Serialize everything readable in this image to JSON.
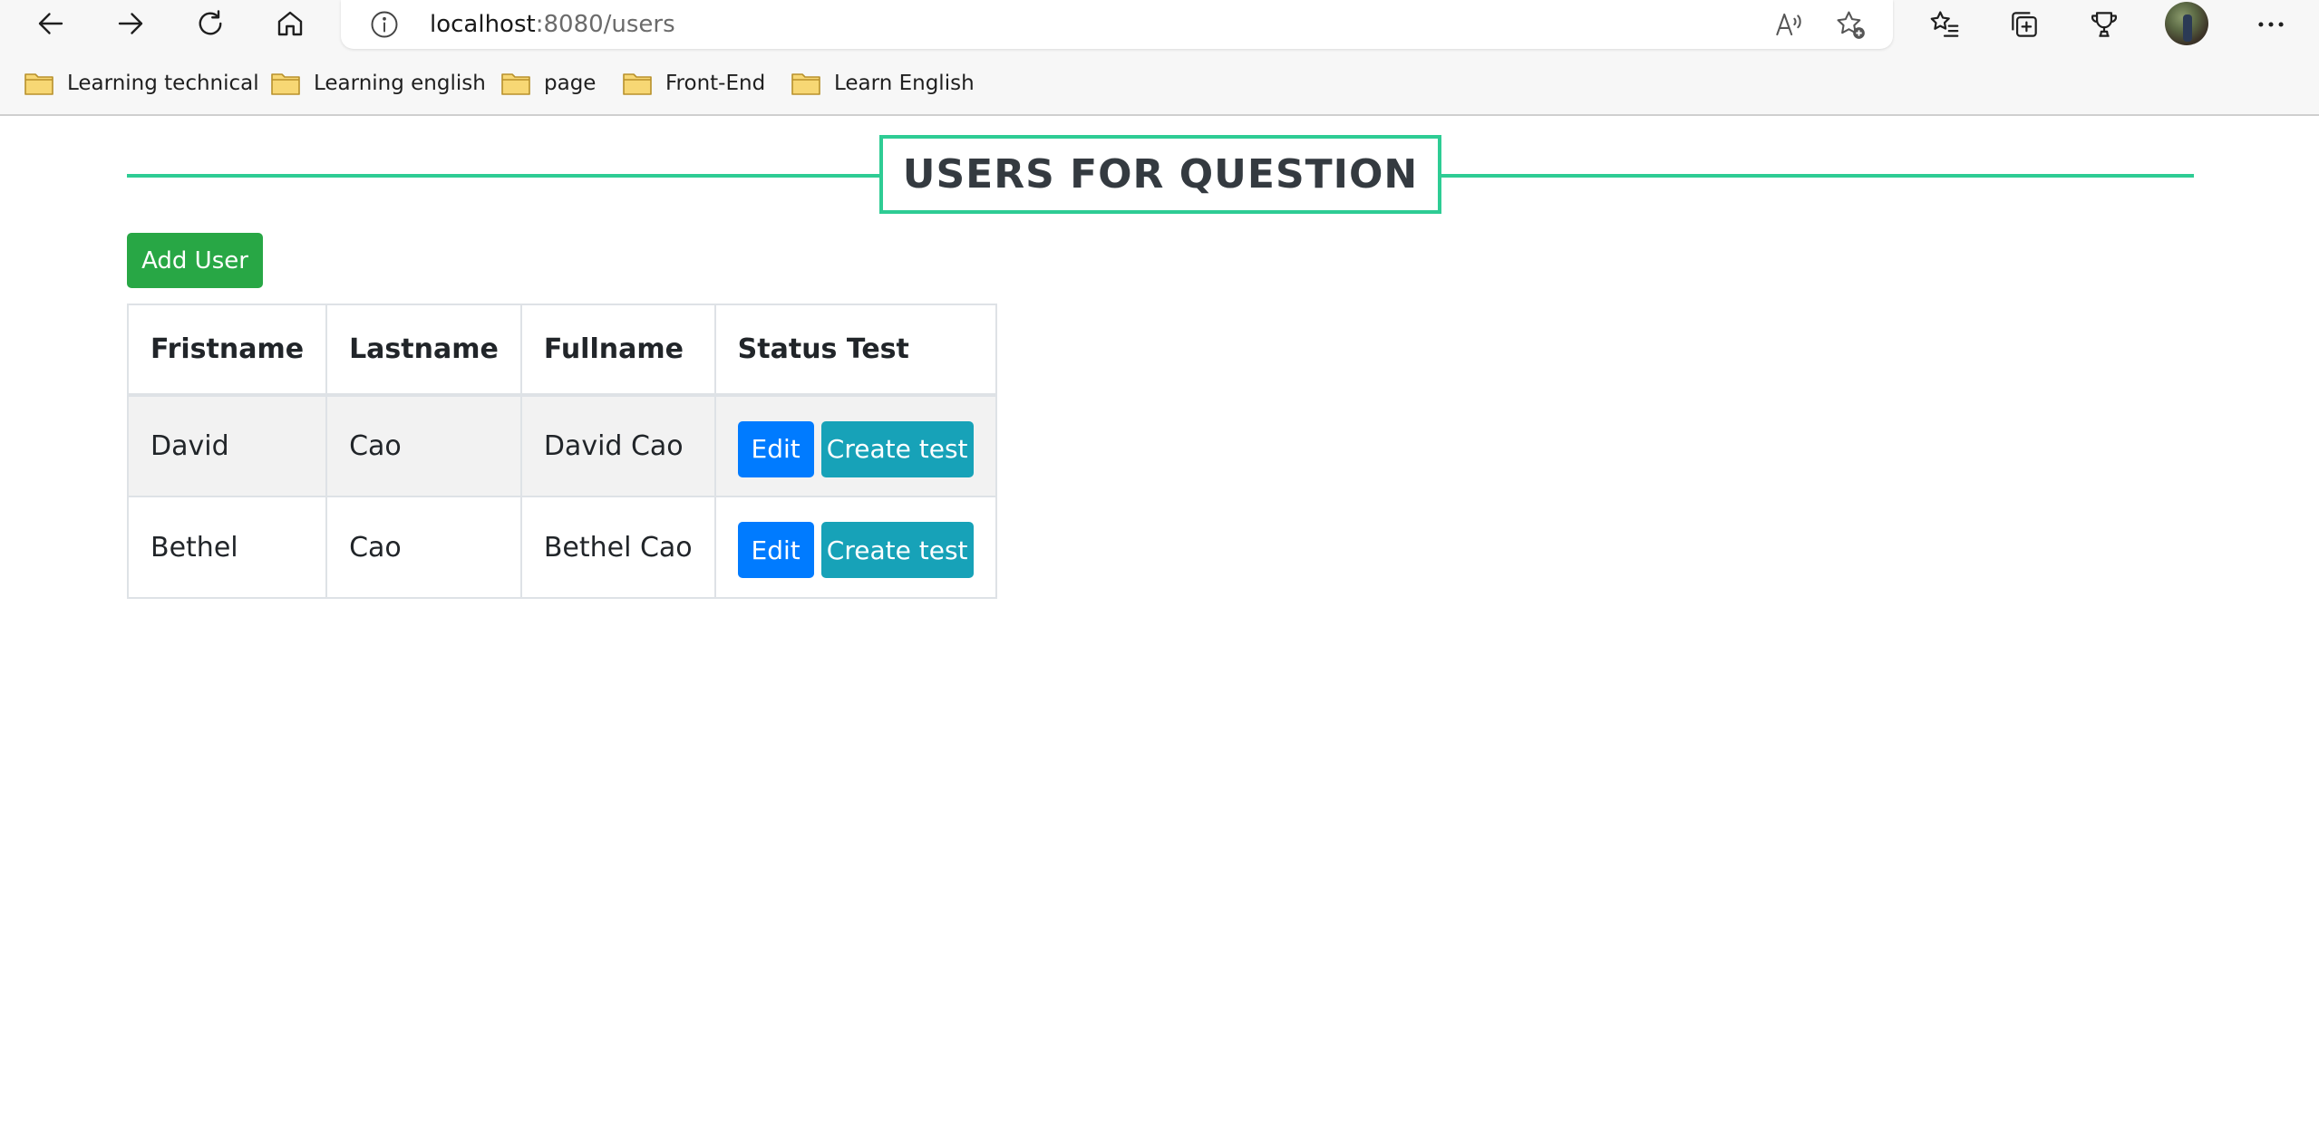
{
  "browser": {
    "url_host": "localhost",
    "url_path": ":8080/users",
    "icons": {
      "back": "arrow-left-icon",
      "forward": "arrow-right-icon",
      "refresh": "refresh-icon",
      "home": "home-icon",
      "site_info": "info-icon",
      "read_aloud": "read-aloud-icon",
      "add_favorite": "star-add-icon",
      "favorites": "favorites-list-icon",
      "collections": "collections-icon",
      "extensions": "trophy-icon",
      "menu": "more-dots-icon"
    },
    "bookmarks": [
      {
        "label": "Learning technical"
      },
      {
        "label": "Learning english"
      },
      {
        "label": "page"
      },
      {
        "label": "Front-End"
      },
      {
        "label": "Learn English"
      }
    ]
  },
  "page": {
    "title": "USERS FOR QUESTION",
    "add_user_label": "Add User",
    "accent_color": "#2ecc94",
    "table": {
      "headers": [
        "Fristname",
        "Lastname",
        "Fullname",
        "Status Test"
      ],
      "rows": [
        {
          "firstname": "David",
          "lastname": "Cao",
          "fullname": "David Cao",
          "edit_label": "Edit",
          "create_label": "Create test"
        },
        {
          "firstname": "Bethel",
          "lastname": "Cao",
          "fullname": "Bethel Cao",
          "edit_label": "Edit",
          "create_label": "Create test"
        }
      ]
    }
  },
  "colors": {
    "add_user": "#28a745",
    "edit": "#007bff",
    "create_test": "#17a2b8",
    "folder": "#f7d774"
  }
}
